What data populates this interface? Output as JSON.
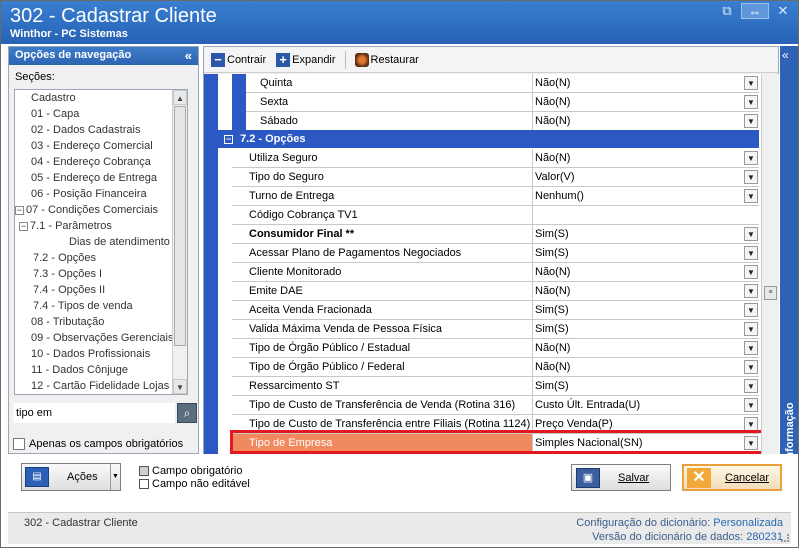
{
  "window": {
    "title": "302 - Cadastrar Cliente",
    "subtitle": "Winthor - PC Sistemas",
    "controls": [
      "restore-icon",
      "expand-icon",
      "close-icon"
    ]
  },
  "nav": {
    "header": "Opções de navegação",
    "collapse": "«",
    "sections_label": "Seções:",
    "items": [
      {
        "label": "Cadastro",
        "indent": 0
      },
      {
        "label": "01 - Capa",
        "indent": 0
      },
      {
        "label": "02 - Dados Cadastrais",
        "indent": 0
      },
      {
        "label": "03 - Endereço Comercial",
        "indent": 0
      },
      {
        "label": "04 - Endereço Cobrança",
        "indent": 0
      },
      {
        "label": "05 - Endereço de Entrega",
        "indent": 0
      },
      {
        "label": "06 - Posição Financeira",
        "indent": 0
      },
      {
        "label": "07 - Condições Comerciais",
        "indent": 0,
        "expander": "−"
      },
      {
        "label": "7.1 - Parâmetros",
        "indent": 1,
        "expander": "−"
      },
      {
        "label": "Dias de atendimento",
        "indent": 2
      },
      {
        "label": "7.2 - Opções",
        "indent": 1
      },
      {
        "label": "7.3 - Opções I",
        "indent": 1
      },
      {
        "label": "7.4 - Opções II",
        "indent": 1
      },
      {
        "label": "7.4 - Tipos de venda",
        "indent": 1
      },
      {
        "label": "08 - Tributação",
        "indent": 0
      },
      {
        "label": "09 - Observações Gerenciais",
        "indent": 0
      },
      {
        "label": "10 - Dados Profissionais",
        "indent": 0
      },
      {
        "label": "11 - Dados Cônjuge",
        "indent": 0
      },
      {
        "label": "12 - Cartão Fidelidade Lojas",
        "indent": 0
      }
    ],
    "search_value": "tipo em",
    "search_icon": "magnifier-icon",
    "required_only_label": "Apenas os campos obrigatórios"
  },
  "toolbar": {
    "contrair": "Contrair",
    "expandir": "Expandir",
    "restaurar": "Restaurar"
  },
  "grid": {
    "top_rows": [
      {
        "label": "Quinta",
        "value": "Não(N)"
      },
      {
        "label": "Sexta",
        "value": "Não(N)"
      },
      {
        "label": "Sábado",
        "value": "Não(N)"
      }
    ],
    "group_title": "7.2 - Opções",
    "rows": [
      {
        "label": "Utiliza Seguro",
        "value": "Não(N)",
        "dropdown": true
      },
      {
        "label": "Tipo do Seguro",
        "value": "Valor(V)",
        "dropdown": true
      },
      {
        "label": "Turno de Entrega",
        "value": "Nenhum()",
        "dropdown": true
      },
      {
        "label": "Código Cobrança TV1",
        "value": "",
        "dropdown": false
      },
      {
        "label": "Consumidor Final **",
        "value": "Sim(S)",
        "dropdown": true,
        "bold": true
      },
      {
        "label": "Acessar Plano de Pagamentos Negociados",
        "value": "Sim(S)",
        "dropdown": true
      },
      {
        "label": "Cliente Monitorado",
        "value": "Não(N)",
        "dropdown": true
      },
      {
        "label": "Emite DAE",
        "value": "Não(N)",
        "dropdown": true
      },
      {
        "label": "Aceita Venda Fracionada",
        "value": "Sim(S)",
        "dropdown": true
      },
      {
        "label": "Valida Máxima Venda de Pessoa Física",
        "value": "Sim(S)",
        "dropdown": true
      },
      {
        "label": "Tipo de Órgão Público / Estadual",
        "value": "Não(N)",
        "dropdown": true
      },
      {
        "label": "Tipo de Órgão Público / Federal",
        "value": "Não(N)",
        "dropdown": true
      },
      {
        "label": "Ressarcimento ST",
        "value": "Sim(S)",
        "dropdown": true
      },
      {
        "label": "Tipo de Custo de Transferência de Venda (Rotina 316)",
        "value": "Custo Últ. Entrada(U)",
        "dropdown": true
      },
      {
        "label": "Tipo de Custo de Transferência entre Filiais (Rotina 1124)",
        "value": "Preço Venda(P)",
        "dropdown": true
      },
      {
        "label": "Tipo de Empresa",
        "value": "Simples Nacional(SN)",
        "dropdown": true,
        "highlighted": true
      }
    ]
  },
  "info_tab": {
    "label": "Informação",
    "collapse": "«"
  },
  "actions": {
    "acoes": "Ações",
    "legend_required": "Campo obrigatório",
    "legend_readonly": "Campo não editável",
    "salvar": "Salvar",
    "cancelar": "Cancelar"
  },
  "status": {
    "left": "302 - Cadastrar Cliente",
    "config_label": "Configuração do dicionário:",
    "config_value": "Personalizada",
    "version_label": "Versão do dicionário de dados:",
    "version_value": "280231"
  },
  "colors": {
    "title_blue": "#2e6fc2",
    "grid_blue": "#2c58c4",
    "highlight": "#f08a5e",
    "red_box": "#e3181f",
    "cancel_orange": "#e9a23b"
  }
}
